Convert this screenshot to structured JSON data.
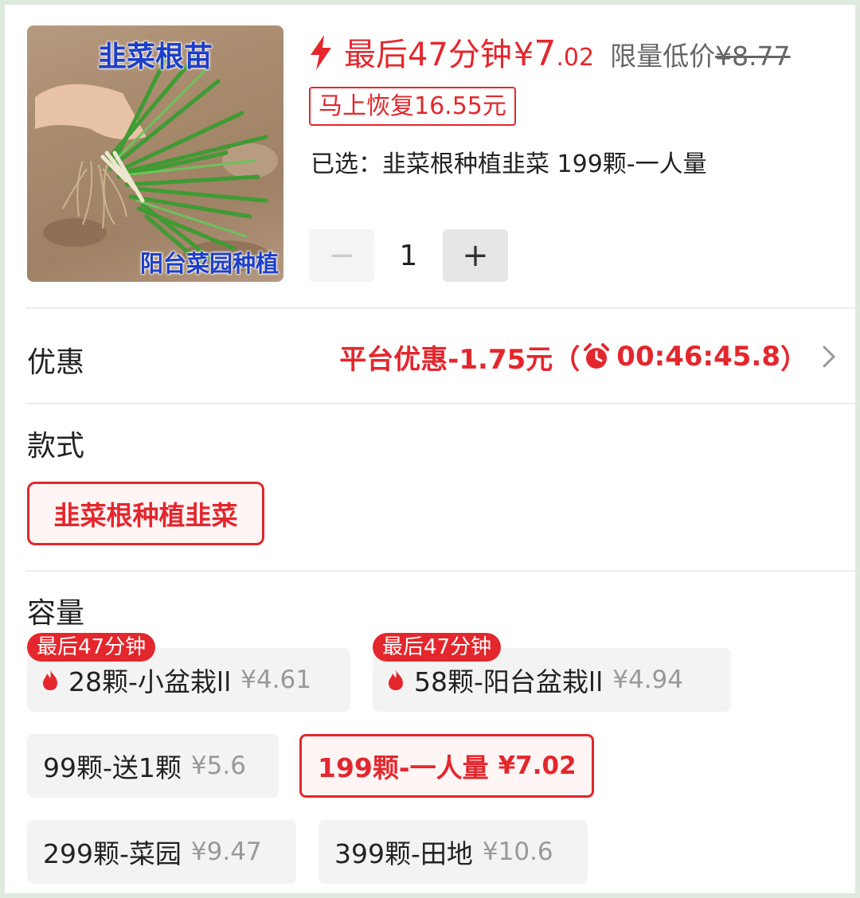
{
  "product": {
    "image_caption_top": "韭菜根苗",
    "image_caption_bottom": "阳台菜园种植",
    "flash_label": "最后47分钟",
    "flash_currency": "¥",
    "flash_price_int": "7",
    "flash_price_dec": ".02",
    "limit_label": "限量低价",
    "limit_price": "¥8.77",
    "restore_tag": "马上恢复16.55元",
    "selected_text": "已选：韭菜根种植韭菜 199颗-一人量",
    "quantity": "1",
    "minus_label": "−",
    "plus_label": "+"
  },
  "promo": {
    "label": "优惠",
    "text_prefix": "平台优惠-1.75元（",
    "countdown": "00:46:45.8",
    "text_suffix": "）"
  },
  "style": {
    "label": "款式",
    "option": "韭菜根种植韭菜"
  },
  "capacity": {
    "label": "容量",
    "options": [
      {
        "badge": "最后47分钟",
        "name": "28颗-小盆栽ll",
        "price": "¥4.61",
        "hot": true,
        "selected": false
      },
      {
        "badge": "最后47分钟",
        "name": "58颗-阳台盆栽ll",
        "price": "¥4.94",
        "hot": true,
        "selected": false
      },
      {
        "name": "99颗-送1颗",
        "price": "¥5.6",
        "hot": false,
        "selected": false
      },
      {
        "name": "199颗-一人量",
        "price": "¥7.02",
        "hot": false,
        "selected": true
      },
      {
        "name": "299颗-菜园",
        "price": "¥9.47",
        "hot": false,
        "selected": false
      },
      {
        "name": "399颗-田地",
        "price": "¥10.6",
        "hot": false,
        "selected": false
      }
    ]
  },
  "colors": {
    "accent": "#e3272d",
    "chip_bg": "#f3f3f3",
    "muted": "#999999"
  },
  "icons": [
    "bolt-icon",
    "alarm-clock-icon",
    "chevron-right-icon",
    "flame-icon",
    "minus-icon",
    "plus-icon"
  ]
}
